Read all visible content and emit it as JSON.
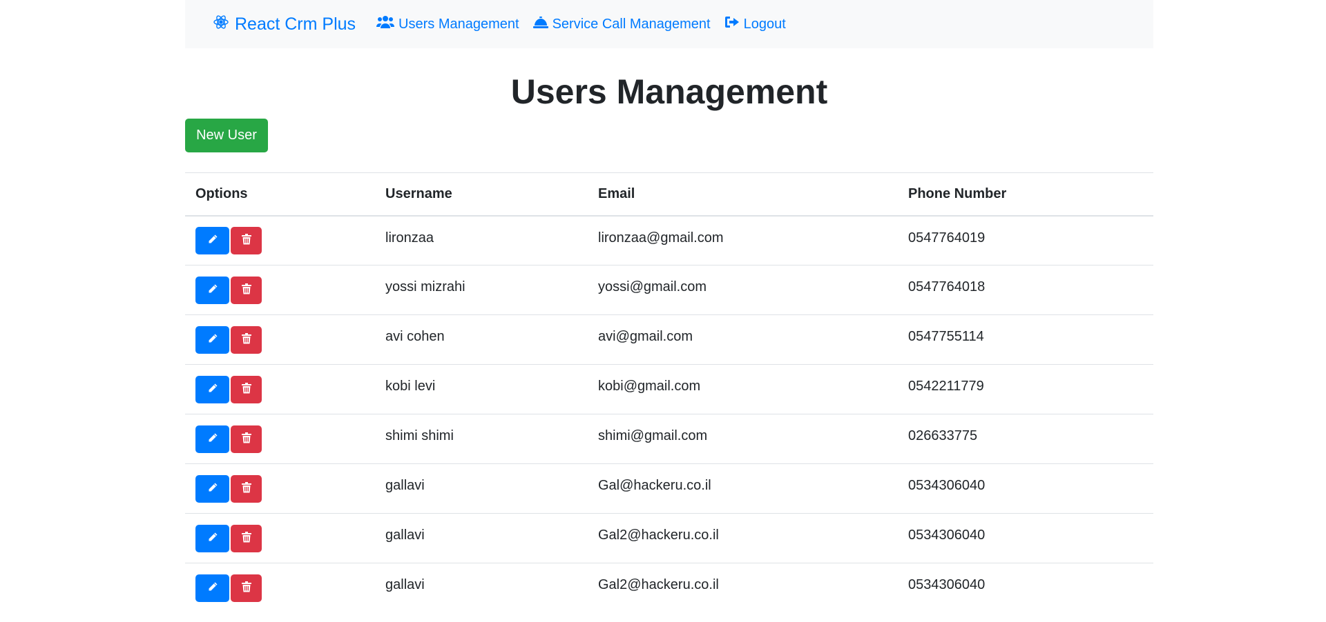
{
  "navbar": {
    "brand": "React Crm Plus",
    "brand_icon": "react-atom-icon",
    "links": [
      {
        "label": "Users Management",
        "icon": "users-icon"
      },
      {
        "label": "Service Call Management",
        "icon": "service-bell-icon"
      },
      {
        "label": "Logout",
        "icon": "sign-out-icon"
      }
    ],
    "link_color": "#007bff"
  },
  "page": {
    "title": "Users Management",
    "new_user_label": "New User"
  },
  "table": {
    "headers": [
      "Options",
      "Username",
      "Email",
      "Phone Number"
    ],
    "rows": [
      {
        "username": "lironzaa",
        "email": "lironzaa@gmail.com",
        "phone": "0547764019"
      },
      {
        "username": "yossi mizrahi",
        "email": "yossi@gmail.com",
        "phone": "0547764018"
      },
      {
        "username": "avi cohen",
        "email": "avi@gmail.com",
        "phone": "0547755114"
      },
      {
        "username": "kobi levi",
        "email": "kobi@gmail.com",
        "phone": "0542211779"
      },
      {
        "username": "shimi shimi",
        "email": "shimi@gmail.com",
        "phone": "026633775"
      },
      {
        "username": "gallavi",
        "email": "Gal@hackeru.co.il",
        "phone": "0534306040"
      },
      {
        "username": "gallavi",
        "email": "Gal2@hackeru.co.il",
        "phone": "0534306040"
      },
      {
        "username": "gallavi",
        "email": "Gal2@hackeru.co.il",
        "phone": "0534306040"
      }
    ],
    "edit_icon": "pencil-icon",
    "delete_icon": "trash-icon"
  },
  "colors": {
    "primary": "#007bff",
    "success": "#28a745",
    "danger": "#dc3545",
    "navbar_bg": "#f8f9fa"
  }
}
